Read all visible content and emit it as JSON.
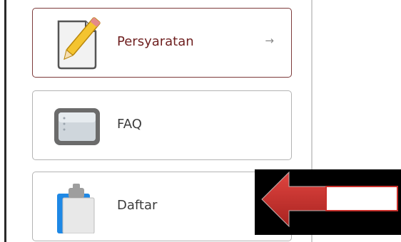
{
  "menu": {
    "items": [
      {
        "label": "Persyaratan",
        "icon": "document-pencil-icon",
        "arrow": "→",
        "active": true
      },
      {
        "label": "FAQ",
        "icon": "panel-icon"
      },
      {
        "label": "Daftar",
        "icon": "clipboard-icon"
      }
    ]
  },
  "colors": {
    "active_border": "#7d3b3b",
    "active_text": "#6e1f1f",
    "card_border": "#b3b3b3",
    "arrow_red": "#c8312c"
  }
}
